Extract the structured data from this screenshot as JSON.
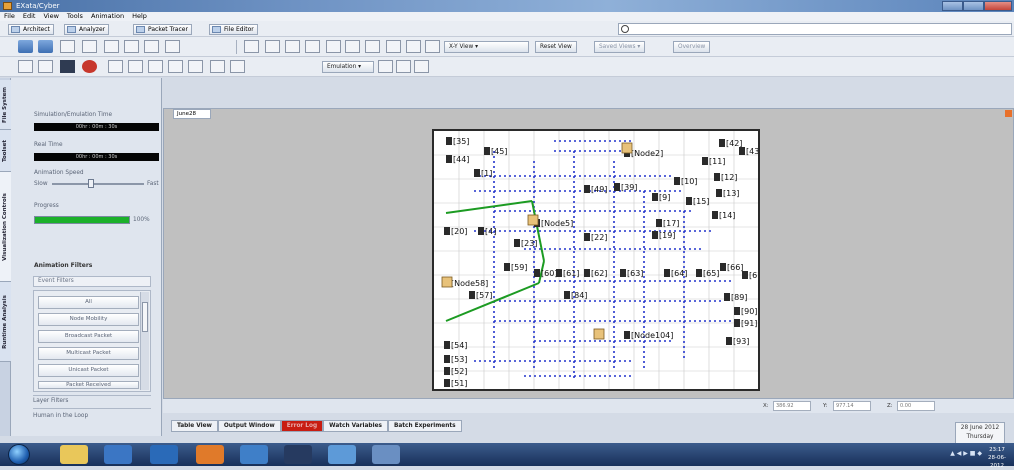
{
  "window": {
    "title": "EXata/Cyber"
  },
  "menu": [
    "File",
    "Edit",
    "View",
    "Tools",
    "Animation",
    "Help"
  ],
  "modes": [
    {
      "label": "Architect"
    },
    {
      "label": "Analyzer"
    },
    {
      "label": "Packet Tracer"
    },
    {
      "label": "File Editor"
    }
  ],
  "toolbar": {
    "view_select": "X-Y View",
    "reset_view": "Reset View",
    "saved_views": "Saved Views",
    "overview": "Overview",
    "run_mode": "Emulation"
  },
  "side_tabs": [
    "File System",
    "Toolset",
    "Visualization Controls",
    "Runtime Analysis"
  ],
  "panel": {
    "sim_time_label": "Simulation/Emulation Time",
    "sim_time_value": "00hr : 00m : 30s",
    "real_time_label": "Real Time",
    "real_time_value": "00hr : 00m : 30s",
    "anim_speed_label": "Animation Speed",
    "slow": "Slow",
    "fast": "Fast",
    "progress_label": "Progress",
    "progress_text": "100%",
    "progress_value": 1.0,
    "anim_filters": "Animation Filters",
    "event_filters": "Event Filters",
    "filters": [
      "All",
      "Node Mobility",
      "Broadcast Packet",
      "Multicast Packet",
      "Unicast Packet",
      "Packet Received"
    ],
    "layer_filters": "Layer Filters",
    "human_loop": "Human in the Loop"
  },
  "canvas": {
    "tab": "June28",
    "nodes": [
      "[35]",
      "[44]",
      "[45]",
      "[Node2]",
      "[42]",
      "[43]",
      "[11]",
      "[1]",
      "[12]",
      "[13]",
      "[10]",
      "[15]",
      "[14]",
      "[49]",
      "[39]",
      "[9]",
      "[17]",
      "[19]",
      "[Node5]",
      "[20]",
      "[4]",
      "[22]",
      "[23]",
      "[59]",
      "[60]",
      "[61]",
      "[62]",
      "[63]",
      "[64]",
      "[65]",
      "[66]",
      "[67]",
      "[Node58]",
      "[57]",
      "[84]",
      "[89]",
      "[90]",
      "[91]",
      "[Node104]",
      "[54]",
      "[53]",
      "[52]",
      "[51]",
      "[93]"
    ]
  },
  "coords": {
    "x_label": "X:",
    "x_value": "386.92",
    "y_label": "Y:",
    "y_value": "977.14",
    "z_label": "Z:",
    "z_value": "0.00"
  },
  "bottom_tabs": [
    "Table View",
    "Output Window",
    "Error Log",
    "Watch Variables",
    "Batch Experiments"
  ],
  "status": {
    "date": "28 June 2012",
    "day": "Thursday"
  },
  "taskbar": {
    "time": "23:17",
    "date": "28-06-2012"
  }
}
